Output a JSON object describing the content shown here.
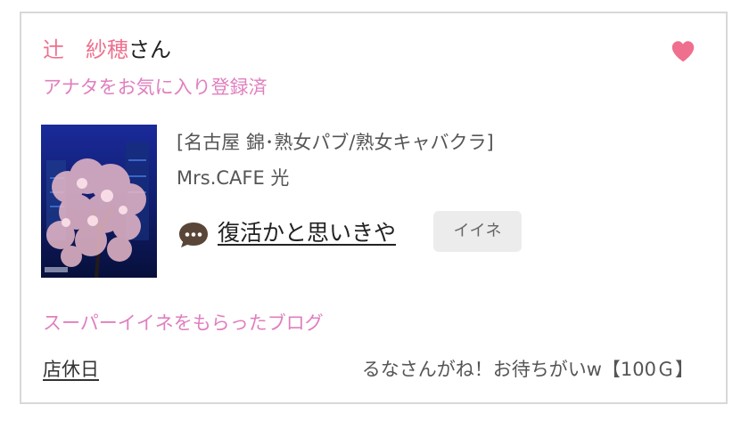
{
  "member": {
    "name": "辻　紗穂",
    "honorific": "さん",
    "favorite_status": "アナタをお気に入り登録済"
  },
  "favorite_icon": "heart-icon",
  "colors": {
    "accent_pink": "#ee6f8e",
    "label_pink": "#e07fbf",
    "button_bg": "#ececec"
  },
  "post": {
    "shop_area": "[名古屋 錦･熟女パブ/熟女キャバクラ]",
    "shop_name": "Mrs.CAFE 光",
    "comment_icon": "speech-bubble-icon",
    "title": "復活かと思いきや",
    "like_label": "イイネ"
  },
  "super_like": {
    "heading": "スーパーイイネをもらったブログ",
    "blog_title": "店休日",
    "message": "るなさんがね！お待ちがいw【100Ｇ】"
  }
}
